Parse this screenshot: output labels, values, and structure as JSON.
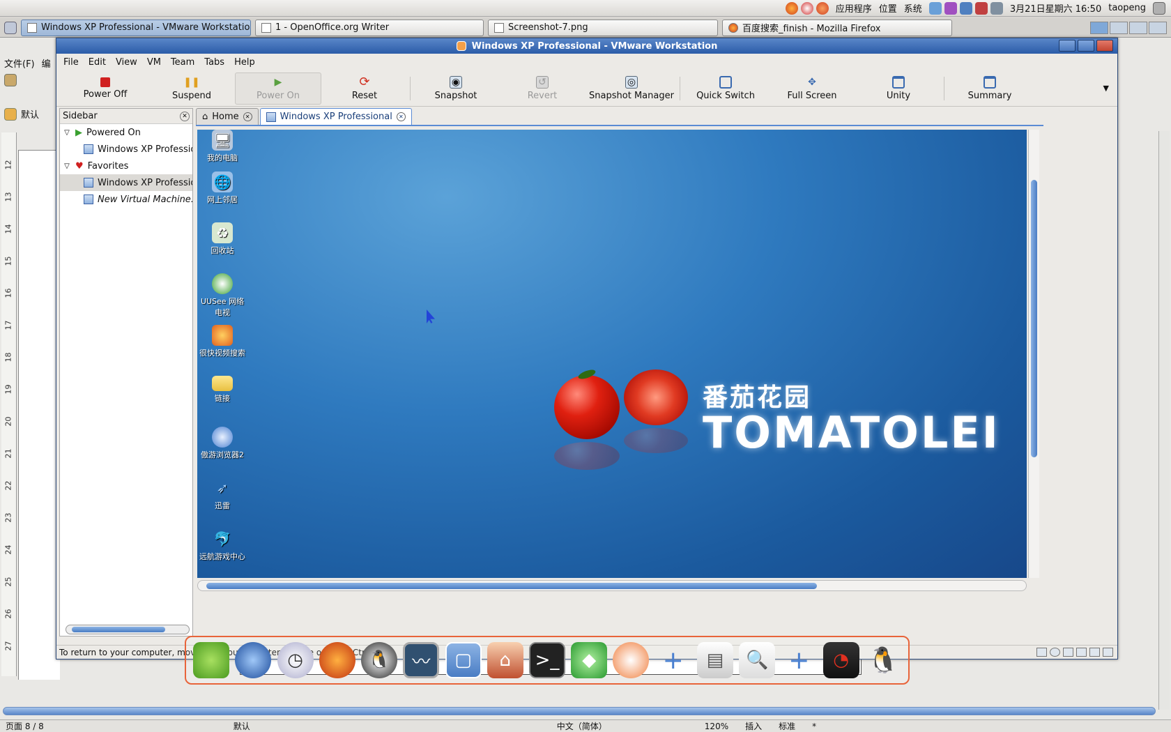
{
  "gnome_panel": {
    "menu_apps": "应用程序",
    "menu_places": "位置",
    "menu_system": "系统",
    "clock": "3月21日星期六 16:50",
    "user": "taopeng"
  },
  "taskbar": {
    "tasks": [
      {
        "label": "Windows XP Professional - VMware Workstation",
        "active": true
      },
      {
        "label": "1 - OpenOffice.org Writer",
        "active": false
      },
      {
        "label": "Screenshot-7.png",
        "active": false
      },
      {
        "label": "百度搜索_finish - Mozilla Firefox",
        "active": false
      }
    ]
  },
  "writer_bg": {
    "menu_file": "文件(F)",
    "menu_edit": "编",
    "style_box": "默认",
    "page_status": "页面 8 / 8",
    "status_default": "默认",
    "status_lang": "中文（简体）",
    "status_zoom": "120%",
    "status_insert": "插入",
    "status_std": "标准",
    "status_star": "*",
    "ruler": [
      "12",
      "13",
      "14",
      "15",
      "16",
      "17",
      "18",
      "19",
      "20",
      "21",
      "22",
      "23",
      "24",
      "25",
      "26",
      "27"
    ]
  },
  "vmware": {
    "title": "Windows XP Professional - VMware Workstation",
    "menu": [
      "File",
      "Edit",
      "View",
      "VM",
      "Team",
      "Tabs",
      "Help"
    ],
    "toolbar": {
      "power_off": "Power Off",
      "suspend": "Suspend",
      "power_on": "Power On",
      "reset": "Reset",
      "snapshot": "Snapshot",
      "revert": "Revert",
      "snapshot_manager": "Snapshot Manager",
      "quick_switch": "Quick Switch",
      "full_screen": "Full Screen",
      "unity": "Unity",
      "summary": "Summary"
    },
    "sidebar": {
      "title": "Sidebar",
      "group_powered": "Powered On",
      "powered_vm": "Windows XP Professior",
      "group_favorites": "Favorites",
      "fav_vm1": "Windows XP Professior",
      "fav_vm2": "New Virtual Machine..."
    },
    "tabs": {
      "home": "Home",
      "vm": "Windows XP Professional"
    },
    "status": "To return to your computer, move the mouse pointer outside or press Ctrl-Alt."
  },
  "guest_desktop": {
    "icons": [
      "我的电脑",
      "网上邻居",
      "回收站",
      "UUSee 网络电视",
      "很快视频搜索",
      "链接",
      "傲游浏览器2",
      "迅雷",
      "远航游戏中心"
    ],
    "brand_cn": "番茄花园",
    "brand_en": "TOMATOLEI"
  },
  "colors": {
    "titlebar": "#2b5ca8",
    "desktop": "#1b5a9e",
    "dock_border": "#e8643a"
  }
}
